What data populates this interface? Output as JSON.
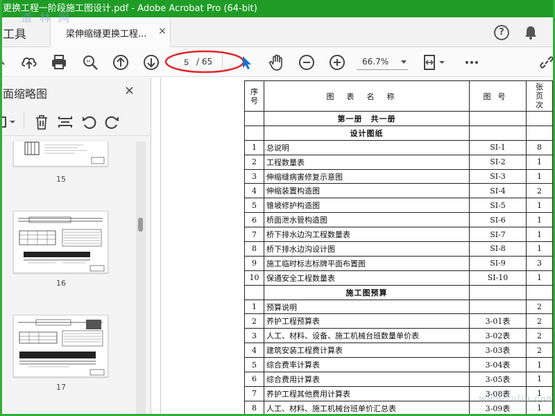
{
  "window": {
    "title": "更换工程一阶段施工图设计.pdf - Adobe Acrobat Pro (64-bit)",
    "watermark_top": "道 林 网",
    "watermark_bottom": "www.tulin.com",
    "frame_color": "#2fae39",
    "titlebar_color": "#1f9c26"
  },
  "tabs": {
    "tools_label": "工具",
    "document_label": "梁伸缩缝更换工程...",
    "close_glyph": "×",
    "help_glyph": "?"
  },
  "toolbar": {
    "icons": [
      "cloud-upload-icon",
      "print-icon",
      "zoom-search-icon",
      "page-up-icon",
      "page-down-icon",
      "select-pointer-icon",
      "hand-tool-icon",
      "zoom-out-icon",
      "zoom-in-icon",
      "fit-page-icon",
      "more-icon",
      "link-icon"
    ],
    "current_page": "5",
    "total_pages": "/ 65",
    "zoom": "66.7%",
    "annotation_color": "#e0282a"
  },
  "left_panel": {
    "title": "面缩略图",
    "close_glyph": "×",
    "tools": [
      "options-icon",
      "delete-icon",
      "extract-icon",
      "rotate-left-icon",
      "rotate-right-icon"
    ],
    "thumbnails": [
      {
        "page": "15"
      },
      {
        "page": "16"
      },
      {
        "page": "17"
      }
    ]
  },
  "index_table": {
    "headers": {
      "no": "序号",
      "name": "图表名称",
      "code": "图号",
      "pages": "张页次"
    },
    "rows": [
      {
        "section": "第一册　共一册"
      },
      {
        "section": "设计图纸"
      },
      {
        "no": "1",
        "name": "总说明",
        "code": "SI-1",
        "pages": "8"
      },
      {
        "no": "2",
        "name": "工程数量表",
        "code": "SI-2",
        "pages": "1"
      },
      {
        "no": "3",
        "name": "伸缩缝病害修复示意图",
        "code": "SI-3",
        "pages": "1"
      },
      {
        "no": "4",
        "name": "伸缩装置构造图",
        "code": "SI-4",
        "pages": "2"
      },
      {
        "no": "5",
        "name": "锥坡修护构造图",
        "code": "SI-5",
        "pages": "1"
      },
      {
        "no": "6",
        "name": "桥面泄水管构造图",
        "code": "SI-6",
        "pages": "1"
      },
      {
        "no": "7",
        "name": "桥下排水边沟工程数量表",
        "code": "SI-7",
        "pages": "1"
      },
      {
        "no": "8",
        "name": "桥下排水边沟设计图",
        "code": "SI-8",
        "pages": "1"
      },
      {
        "no": "9",
        "name": "施工临时标志标牌平面布置图",
        "code": "SI-9",
        "pages": "3"
      },
      {
        "no": "10",
        "name": "保通安全工程数量表",
        "code": "SI-10",
        "pages": "1"
      },
      {
        "section": "施工图预算"
      },
      {
        "no": "1",
        "name": "预算说明",
        "code": "",
        "pages": "2"
      },
      {
        "no": "2",
        "name": "养护工程预算表",
        "code": "3-01表",
        "pages": "2"
      },
      {
        "no": "3",
        "name": "人工、材料、设备、施工机械台班数量单价表",
        "code": "3-02表",
        "pages": "2"
      },
      {
        "no": "4",
        "name": "建筑安装工程费计算表",
        "code": "3-03表",
        "pages": "2"
      },
      {
        "no": "5",
        "name": "综合费率计算表",
        "code": "3-04表",
        "pages": "1"
      },
      {
        "no": "6",
        "name": "综合费用计算表",
        "code": "3-05表",
        "pages": "1"
      },
      {
        "no": "7",
        "name": "养护工程其他费用计算表",
        "code": "3-08表",
        "pages": "1"
      },
      {
        "no": "8",
        "name": "人工、材料、施工机械台班单价汇总表",
        "code": "3-09表",
        "pages": "1"
      }
    ]
  }
}
